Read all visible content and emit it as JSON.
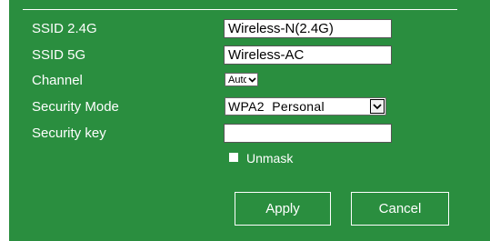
{
  "form": {
    "ssid_24g": {
      "label": "SSID 2.4G",
      "value": "Wireless-N(2.4G)"
    },
    "ssid_5g": {
      "label": "SSID 5G",
      "value": "Wireless-AC"
    },
    "channel": {
      "label": "Channel",
      "selected": "Auto"
    },
    "security_mode": {
      "label": "Security Mode",
      "selected": "WPA2  Personal"
    },
    "security_key": {
      "label": "Security key",
      "value": ""
    },
    "unmask": {
      "label": "Unmask",
      "checked": false
    }
  },
  "buttons": {
    "apply": "Apply",
    "cancel": "Cancel"
  },
  "colors": {
    "panel_background": "#2a8e3f",
    "text": "#ffffff",
    "button_border": "#ffffff"
  },
  "icons": {
    "dropdown": "chevron-down-icon"
  }
}
